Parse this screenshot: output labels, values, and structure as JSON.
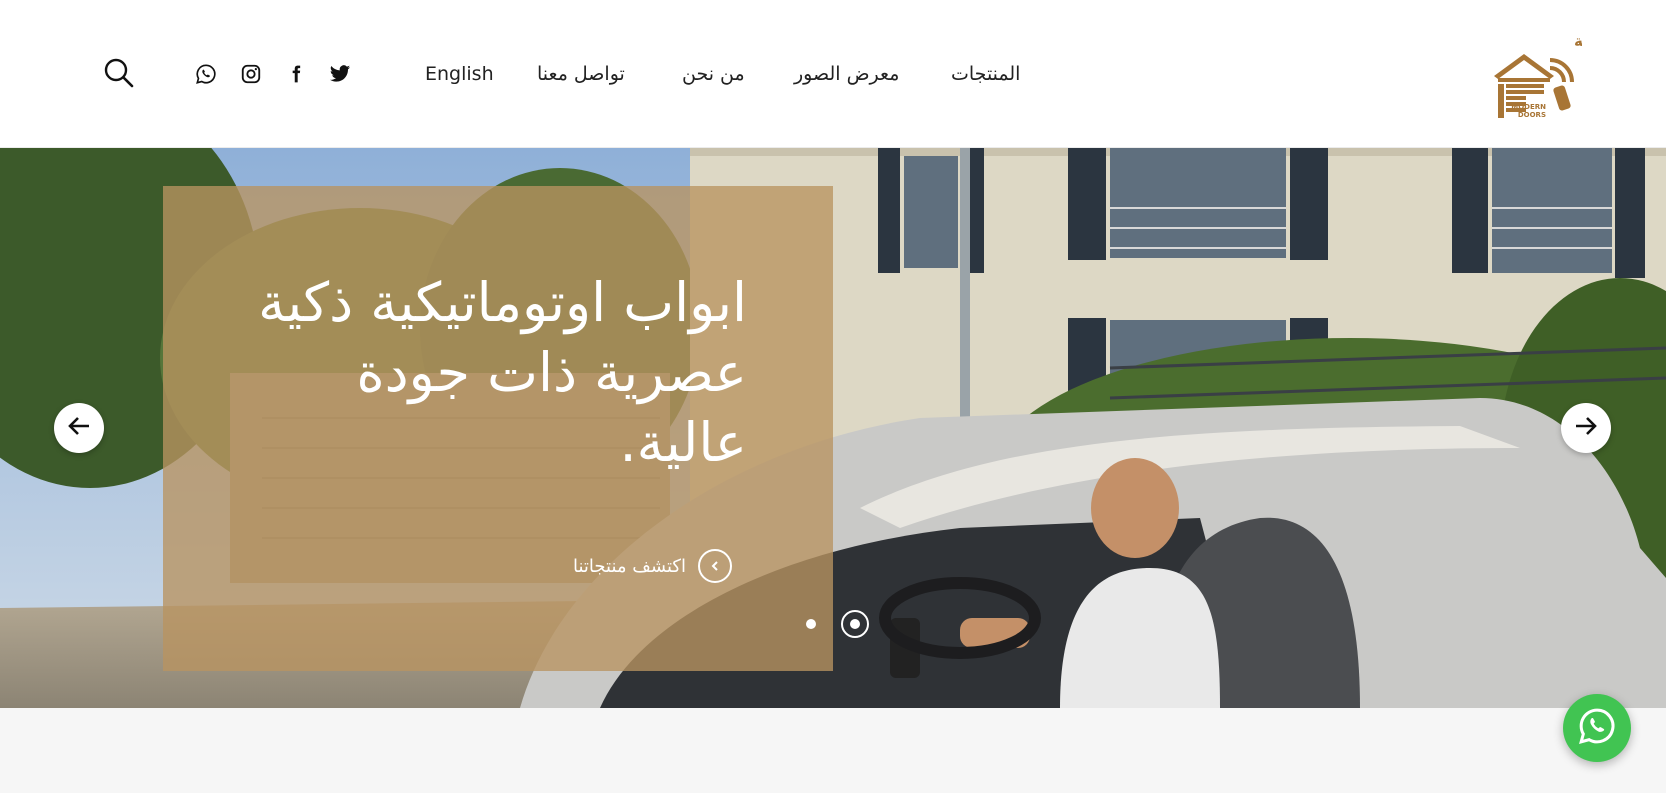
{
  "header": {
    "logo": {
      "text_ar": "الابواب العصرية",
      "text_en_line1": "MODERN",
      "text_en_line2": "DOORS"
    },
    "nav": [
      {
        "label": "المنتجات"
      },
      {
        "label": "معرض الصور"
      },
      {
        "label": "من نحن"
      },
      {
        "label": "تواصل معنا"
      },
      {
        "label": "English"
      }
    ],
    "social_icons": [
      "twitter-icon",
      "facebook-icon",
      "instagram-icon",
      "whatsapp-icon"
    ],
    "search_icon": "search-icon"
  },
  "hero": {
    "headline": "ابواب اوتوماتيكية ذكية عصرية ذات جودة عالية.",
    "cta_label": "اكتشف منتجاتنا",
    "slides_count": 2,
    "active_slide": 2,
    "prev_icon": "arrow-left-icon",
    "next_icon": "arrow-right-icon"
  },
  "floating": {
    "icon": "whatsapp-icon"
  },
  "colors": {
    "accent": "#b89460",
    "logo": "#a87535",
    "whatsapp": "#41c452"
  }
}
